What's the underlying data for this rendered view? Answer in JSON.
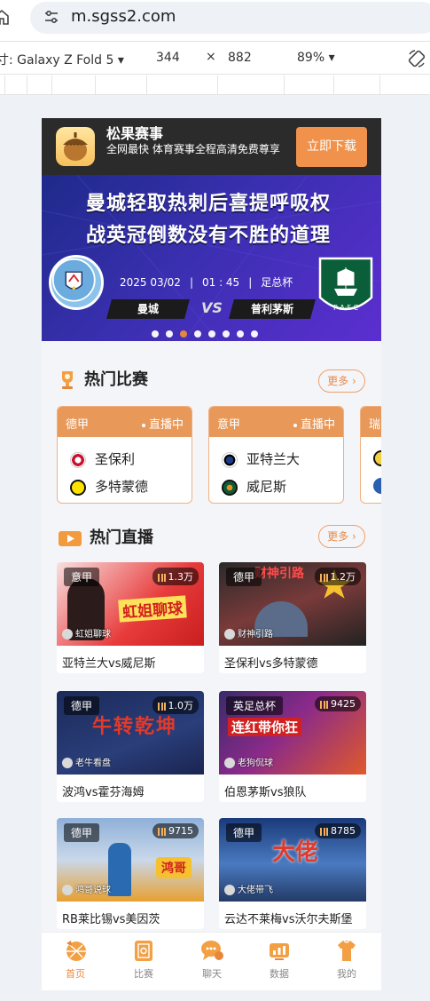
{
  "browser": {
    "url": "m.sgss2.com",
    "device_label": "寸: Galaxy Z Fold 5 ▾",
    "width": "344",
    "times": "×",
    "height": "882",
    "zoom": "89% ▾"
  },
  "download_bar": {
    "app_name": "松果赛事",
    "description": "全网最快 体育赛事全程高清免费尊享",
    "button": "立即下载"
  },
  "banner": {
    "headline1": "曼城轻取热刺后喜提呼吸权",
    "headline2": "战英冠倒数没有不胜的道理",
    "date": "2025 03/02",
    "time": "01 : 45",
    "competition": "足总杯",
    "home_team": "曼城",
    "away_team": "普利茅斯",
    "vs": "VS",
    "home_badge_text": "MANCHESTER CITY",
    "away_badge_text": "P.A.F.C"
  },
  "hot_matches": {
    "title": "热门比赛",
    "more": "更多",
    "cards": [
      {
        "league": "德甲",
        "status": "直播中",
        "team1": "圣保利",
        "team2": "多特蒙德"
      },
      {
        "league": "意甲",
        "status": "直播中",
        "team1": "亚特兰大",
        "team2": "威尼斯"
      },
      {
        "league": "瑞",
        "status": "",
        "team1": "",
        "team2": ""
      }
    ]
  },
  "hot_live": {
    "title": "热门直播",
    "more": "更多",
    "cards": [
      {
        "tag": "意甲",
        "views": "1.3万",
        "anchor": "虹姐聊球",
        "caption": "亚特兰大vs威尼斯",
        "overlay": "虹姐聊球"
      },
      {
        "tag": "德甲",
        "views": "1.2万",
        "anchor": "财神引路",
        "caption": "圣保利vs多特蒙德",
        "overlay": "财神引路"
      },
      {
        "tag": "德甲",
        "views": "1.0万",
        "anchor": "老牛看盘",
        "caption": "波鸿vs霍芬海姆",
        "overlay": "牛转乾坤"
      },
      {
        "tag": "英足总杯",
        "views": "9425",
        "anchor": "老狗侃球",
        "caption": "伯恩茅斯vs狼队",
        "overlay": "连红带你狂"
      },
      {
        "tag": "德甲",
        "views": "9715",
        "anchor": "鸿哥说球",
        "caption": "RB莱比锡vs美因茨",
        "overlay": "鸿哥"
      },
      {
        "tag": "德甲",
        "views": "8785",
        "anchor": "大佬带飞",
        "caption": "云达不莱梅vs沃尔夫斯堡",
        "overlay": "大佬"
      }
    ]
  },
  "tabbar": {
    "items": [
      {
        "label": "首页",
        "icon": "home-ball-icon",
        "active": true
      },
      {
        "label": "比赛",
        "icon": "match-icon",
        "active": false
      },
      {
        "label": "聊天",
        "icon": "chat-icon",
        "active": false
      },
      {
        "label": "数据",
        "icon": "data-icon",
        "active": false
      },
      {
        "label": "我的",
        "icon": "profile-icon",
        "active": false
      }
    ]
  },
  "colors": {
    "accent": "#ef8a3a",
    "dark_bar": "#2b2b2b",
    "card_header": "#e8995a"
  }
}
